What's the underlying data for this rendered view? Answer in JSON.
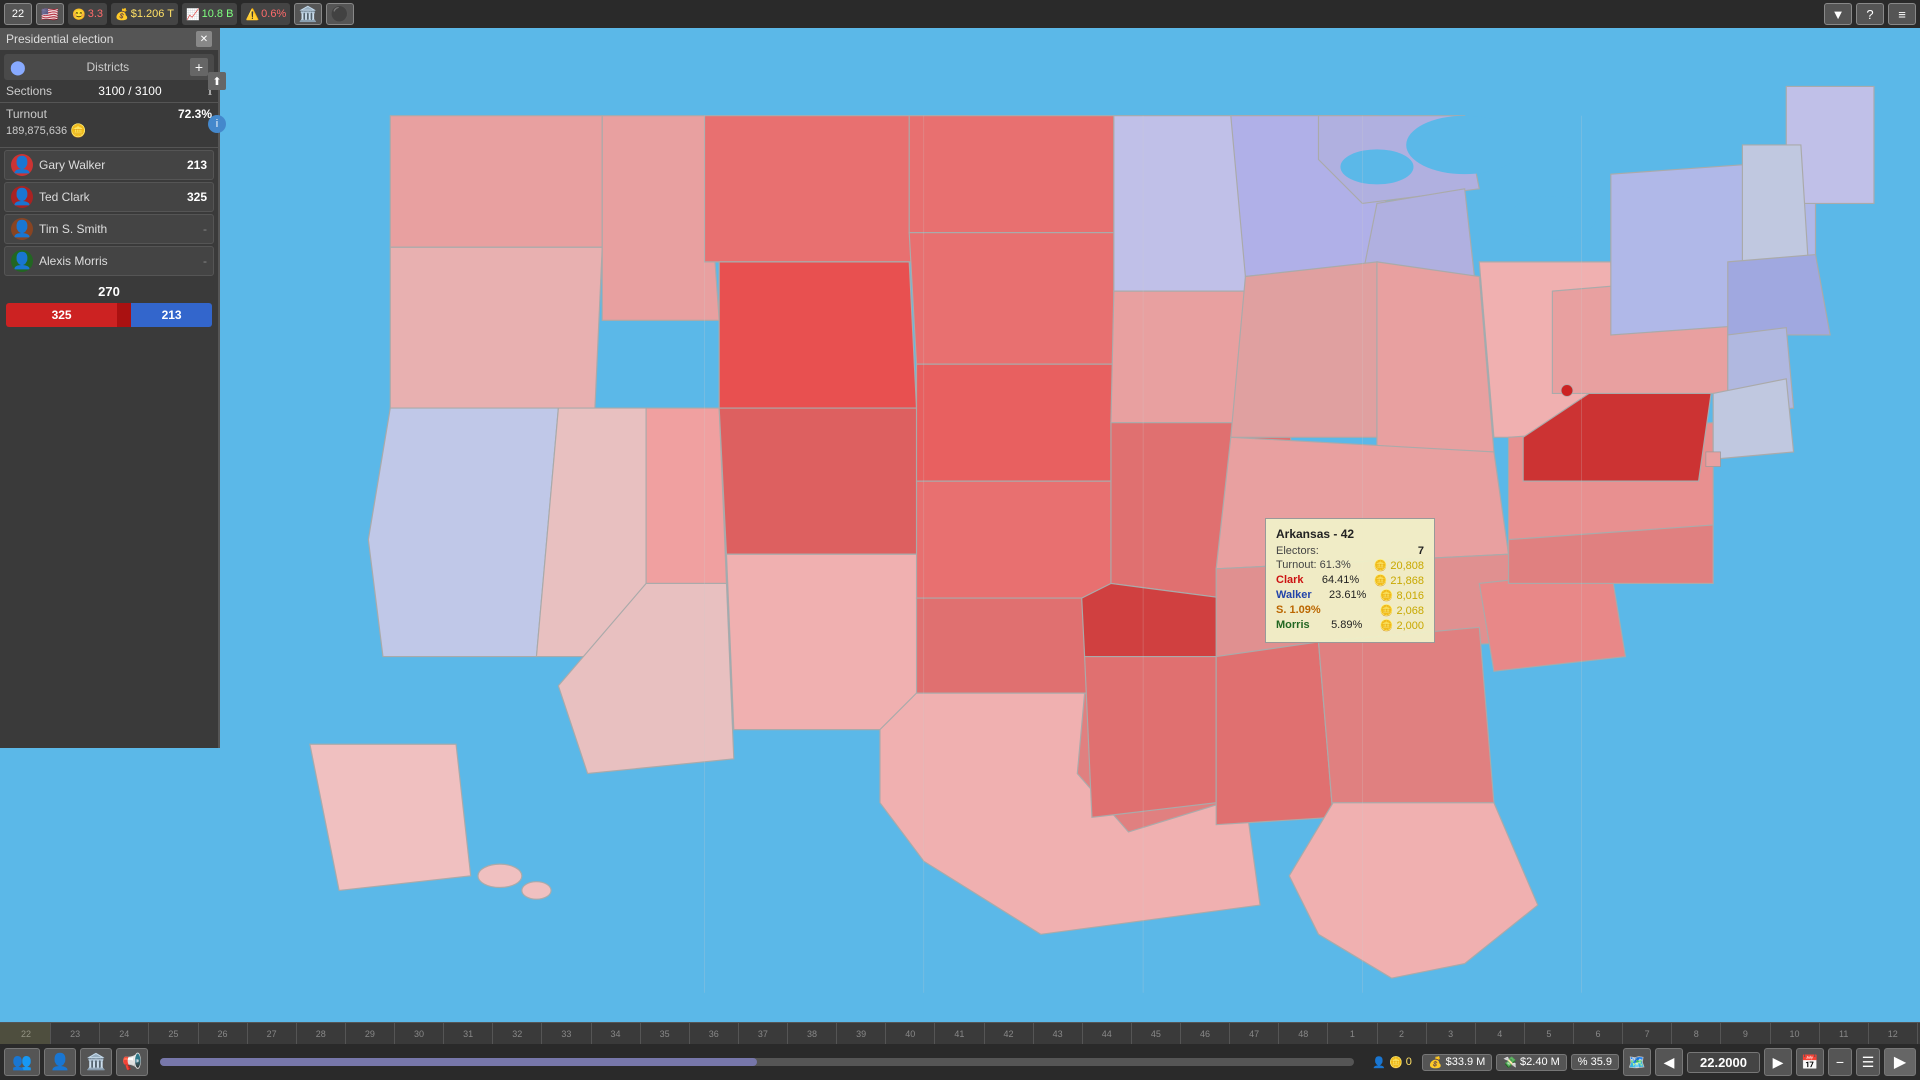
{
  "topbar": {
    "year_label": "22",
    "flag": "🇺🇸",
    "stat1": {
      "icon": "😊",
      "value": "3.3",
      "color": "red"
    },
    "stat2": {
      "icon": "💰",
      "value": "$1.206 T",
      "color": "yellow"
    },
    "stat3": {
      "icon": "📈",
      "value": "10.8 B",
      "color": "green"
    },
    "stat4": {
      "icon": "⚠️",
      "value": "0.6%",
      "color": "red"
    },
    "building_icon": "🏛️",
    "filter_icon": "▼",
    "help_icon": "?",
    "settings_icon": "≡"
  },
  "panel": {
    "title": "Presidential election",
    "districts_label": "Districts",
    "sections_label": "Sections",
    "sections_value": "3100 / 3100",
    "turnout_label": "Turnout",
    "turnout_pct": "72.3%",
    "turnout_count": "189,875,636",
    "candidates": [
      {
        "name": "Gary Walker",
        "score": "213",
        "flag": "🔴",
        "dash": false
      },
      {
        "name": "Ted Clark",
        "score": "325",
        "flag": "🔴",
        "dash": false
      },
      {
        "name": "Tim S. Smith",
        "score": "",
        "flag": "🔴",
        "dash": true
      },
      {
        "name": "Alexis Morris",
        "score": "",
        "flag": "🟢",
        "dash": true
      }
    ],
    "threshold": "270",
    "score_red": "325",
    "score_blue": "213",
    "score_red_width": 55,
    "score_blue_width": 40
  },
  "tooltip": {
    "title": "Arkansas - 42",
    "electors_label": "Electors:",
    "electors_value": "7",
    "turnout_label": "Turnout: 61.3%",
    "turnout_coin": "20,808",
    "clark_label": "Clark",
    "clark_pct": "64.41%",
    "clark_coin": "21,868",
    "walker_label": "Walker",
    "walker_pct": "23.61%",
    "walker_coin": "8,016",
    "smith_label": "S. 1.09%",
    "smith_coin": "2,068",
    "morris_label": "Morris",
    "morris_pct": "5.89%",
    "morris_coin": "2,000"
  },
  "bottombar": {
    "people_icon": "👥",
    "person_icon": "👤",
    "coin_icon": "🪙",
    "building_icon": "🏛️",
    "speaker_icon": "📢",
    "money1": "$33.9 M",
    "money2": "$2.40 M",
    "pct": "35.9",
    "year": "22.2000",
    "right_icon": "▶",
    "left_icon": "◀",
    "minus_icon": "−",
    "list_icon": "☰",
    "map_icon": "🗺️"
  },
  "timeline": {
    "ticks": [
      "22",
      "23",
      "24",
      "25",
      "26",
      "27",
      "28",
      "29",
      "30",
      "31",
      "32",
      "33",
      "34",
      "35",
      "36",
      "37",
      "38",
      "39",
      "40",
      "41",
      "42",
      "43",
      "44",
      "45",
      "46",
      "47",
      "48",
      "1",
      "2",
      "3",
      "4",
      "5",
      "6",
      "7",
      "8",
      "9",
      "10",
      "11",
      "12"
    ]
  }
}
